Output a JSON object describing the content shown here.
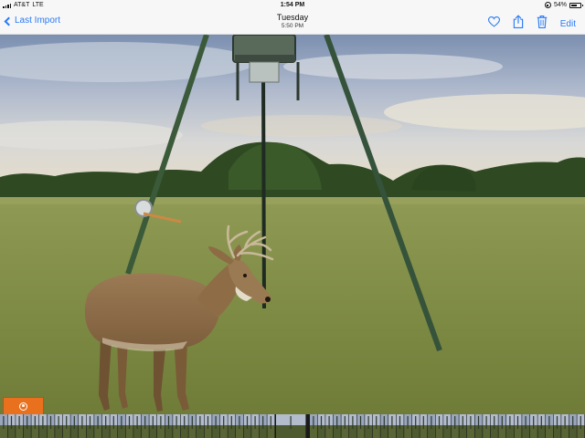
{
  "status": {
    "carrier": "AT&T",
    "network": "LTE",
    "time": "1:54 PM",
    "battery": "54%"
  },
  "nav": {
    "back_label": "Last Import",
    "day": "Tuesday",
    "photo_time": "5:50 PM",
    "edit_label": "Edit",
    "icons": [
      "heart-icon",
      "share-icon",
      "trash-icon"
    ],
    "accent_color": "#2a7bf6"
  },
  "photo": {
    "subject": "whitetail buck in field under tripod feeder"
  },
  "strip": {
    "live_badge_icon": "live-photo-icon",
    "live_color": "#e9711d"
  }
}
